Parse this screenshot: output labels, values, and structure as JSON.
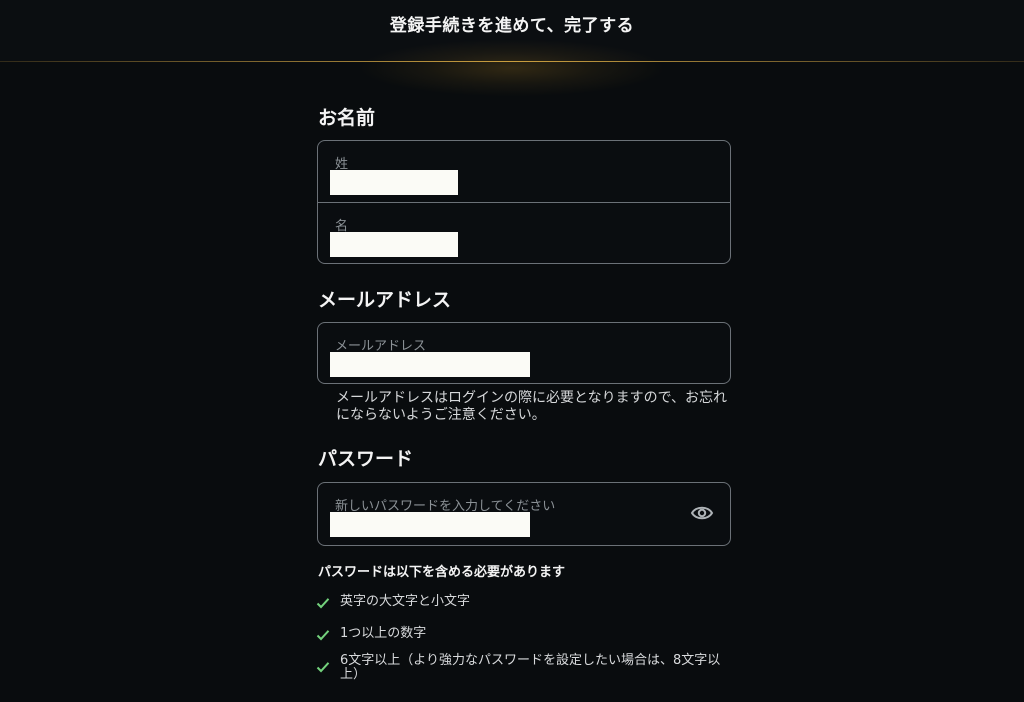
{
  "header": {
    "title": "登録手続きを進めて、完了する"
  },
  "name_section": {
    "title": "お名前",
    "last_name_label": "姓",
    "first_name_label": "名"
  },
  "email_section": {
    "title": "メールアドレス",
    "email_label": "メールアドレス",
    "hint": "メールアドレスはログインの際に必要となりますので、お忘れにならないようご注意ください。"
  },
  "password_section": {
    "title": "パスワード",
    "password_label": "新しいパスワードを入力してください",
    "requirements_title": "パスワードは以下を含める必要があります",
    "requirements": [
      "英字の大文字と小文字",
      "1つ以上の数字",
      "6文字以上（より強力なパスワードを設定したい場合は、8文字以上）"
    ]
  },
  "colors": {
    "accent_gold": "#d7aa46",
    "check_green": "#73d27c",
    "background": "#090c0e"
  }
}
